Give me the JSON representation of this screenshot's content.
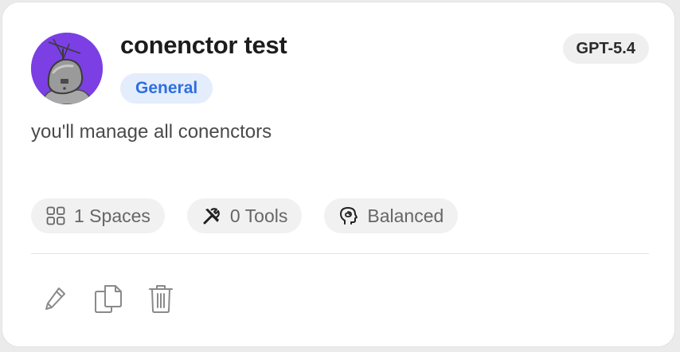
{
  "agent": {
    "name": "conenctor test",
    "category": "General",
    "model": "GPT-5.4",
    "description": "you'll manage all conenctors",
    "avatar": "robot-avatar"
  },
  "stats": [
    {
      "icon": "grid-icon",
      "label": "1 Spaces"
    },
    {
      "icon": "tools-icon",
      "label": "0 Tools"
    },
    {
      "icon": "brain-head-icon",
      "label": "Balanced"
    }
  ],
  "actions": [
    {
      "icon": "edit-icon"
    },
    {
      "icon": "copy-icon"
    },
    {
      "icon": "trash-icon"
    }
  ],
  "colors": {
    "avatar_bg": "#7b3fe4",
    "category_bg": "#e3edfc",
    "category_text": "#2f6fde",
    "chip_bg": "#f1f1f1"
  }
}
